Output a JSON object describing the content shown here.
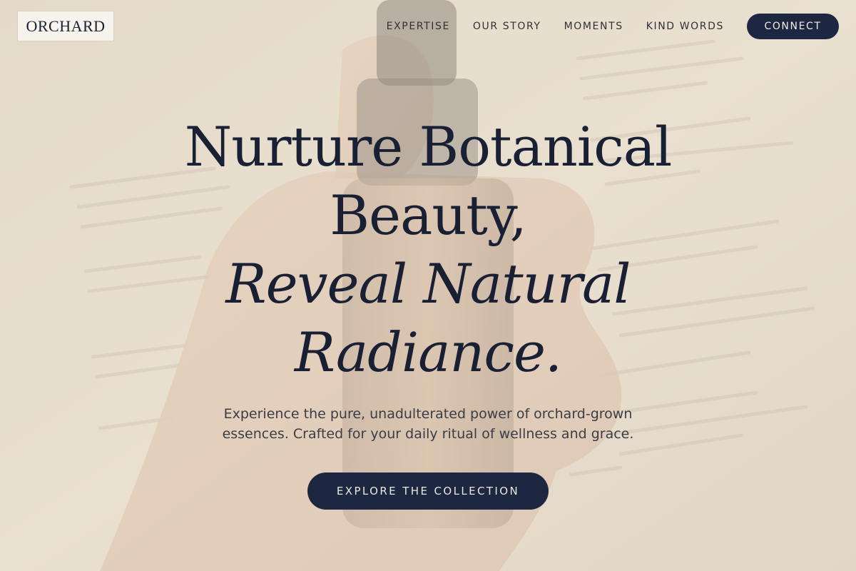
{
  "brand": {
    "logo_text": "ORCHARD"
  },
  "nav": {
    "items": [
      {
        "label": "EXPERTISE"
      },
      {
        "label": "OUR STORY"
      },
      {
        "label": "MOMENTS"
      },
      {
        "label": "KIND WORDS"
      }
    ],
    "connect_label": "CONNECT"
  },
  "hero": {
    "headline_line1": "Nurture Botanical",
    "headline_line2": "Beauty,",
    "headline_line3": "Reveal Natural",
    "headline_line4": "Radiance.",
    "subtitle": "Experience the pure, unadulterated power of orchard-grown essences. Crafted for your daily ritual of wellness and grace.",
    "cta_label": "EXPLORE THE COLLECTION"
  },
  "colors": {
    "primary": "#1e2741",
    "headline": "#1a2034",
    "background": "#e6dccb"
  }
}
